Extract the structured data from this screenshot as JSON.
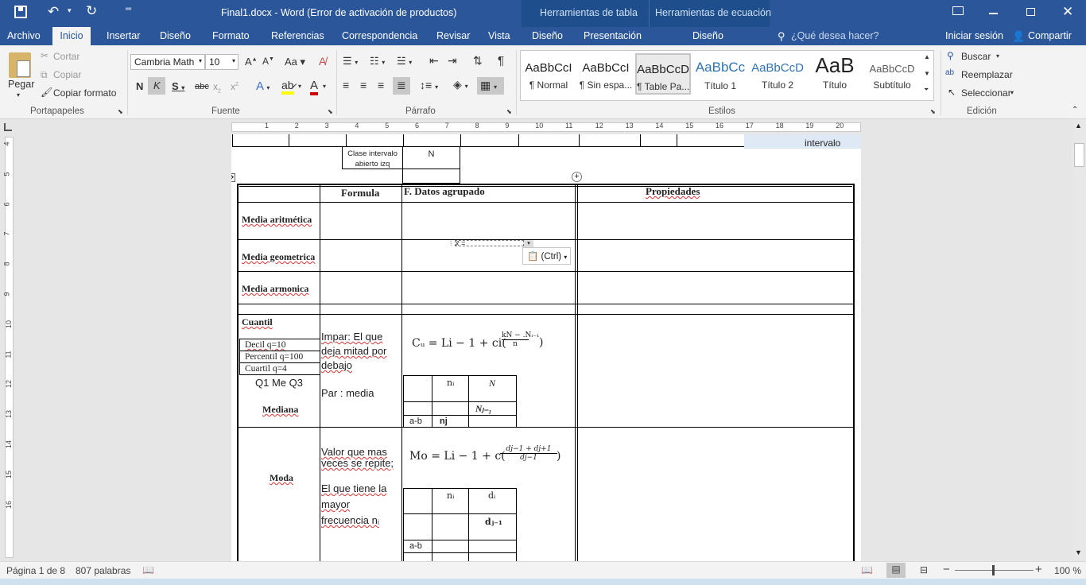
{
  "title_bar": {
    "document_title": "Final1.docx - Word (Error de activación de productos)",
    "context_tools": [
      "Herramientas de tabla",
      "Herramientas de ecuación"
    ]
  },
  "tabs": {
    "archivo": "Archivo",
    "items": [
      "Inicio",
      "Insertar",
      "Diseño",
      "Formato",
      "Referencias",
      "Correspondencia",
      "Revisar",
      "Vista"
    ],
    "context_items": [
      "Diseño",
      "Presentación",
      "Diseño"
    ],
    "tell_me_placeholder": "¿Qué desea hacer?",
    "signin": "Iniciar sesión",
    "share": "Compartir"
  },
  "ribbon": {
    "clipboard": {
      "paste": "Pegar",
      "cut": "Cortar",
      "copy": "Copiar",
      "format_painter": "Copiar formato",
      "label": "Portapapeles"
    },
    "font": {
      "font_name": "Cambria Math",
      "font_size": "10",
      "label": "Fuente"
    },
    "paragraph": {
      "label": "Párrafo"
    },
    "styles": {
      "label": "Estilos",
      "items": [
        {
          "preview": "AaBbCcI",
          "name": "¶ Normal"
        },
        {
          "preview": "AaBbCcI",
          "name": "¶ Sin espa..."
        },
        {
          "preview": "AaBbCcD",
          "name": "¶ Table Pa..."
        },
        {
          "preview": "AaBbCc",
          "name": "Título 1"
        },
        {
          "preview": "AaBbCcD",
          "name": "Título 2"
        },
        {
          "preview": "AaB",
          "name": "Título"
        },
        {
          "preview": "AaBbCcD",
          "name": "Subtítulo"
        }
      ]
    },
    "editing": {
      "find": "Buscar",
      "replace": "Reemplazar",
      "select": "Seleccionar",
      "label": "Edición"
    }
  },
  "ruler_numbers": [
    "1",
    "2",
    "3",
    "4",
    "5",
    "6",
    "7",
    "8",
    "9",
    "10",
    "11",
    "12",
    "13",
    "14",
    "15",
    "16",
    "17",
    "18",
    "19",
    "20"
  ],
  "document": {
    "top_table": {
      "cell_label": "Clase intervalo abierto izq",
      "cell_n": "N",
      "side_text": "intervalo"
    },
    "headers": {
      "formula": "Formula",
      "datos": "F. Datos agrupado",
      "propiedades": "Propiedades"
    },
    "rows": {
      "media_aritmetica": "Media aritmética",
      "media_geometrica": "Media geometrica",
      "media_armonica": "Media armonica",
      "cuantil": "Cuantil",
      "decil": "Decil  q=10",
      "percentil": "Percentil q=100",
      "cuartil": "Cuartil  q=4",
      "q1meq3": "Q1 Me Q3",
      "mediana": "Mediana",
      "moda": "Moda"
    },
    "cuantil_formula_text": {
      "impar": "Impar: El que deja mitad por debajo",
      "par": "Par : media"
    },
    "cuantil_equation": "Cᵤ = Li − 1 + ci(",
    "cuantil_fraction": {
      "num": "kN − .Nᵢ₋₁",
      "den": "n"
    },
    "mini_table_1": {
      "ni": "nᵢ",
      "N": "N",
      "Nj1": "Nⱼ₋₁",
      "ab": "a-b",
      "nj": "nj"
    },
    "moda_text": {
      "line1": "Valor que mas veces se repite;",
      "line2": "El que tiene la mayor frecuencia nᵢ"
    },
    "moda_equation": "Mo = Li − 1 + c(",
    "moda_fraction": {
      "num": "dj−1 + dj+1",
      "den": "dj−1"
    },
    "mini_table_2": {
      "ni": "nᵢ",
      "di": "dᵢ",
      "dj1": "dⱼ₋₁",
      "ab": "a-b"
    },
    "paste_options": "(Ctrl)"
  },
  "status_bar": {
    "page": "Página 1 de 8",
    "words": "807 palabras",
    "zoom": "100 %"
  }
}
